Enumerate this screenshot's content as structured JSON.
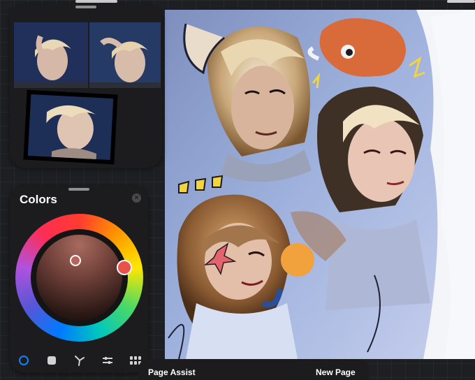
{
  "colors_panel": {
    "title": "Colors",
    "close_icon": "close-icon",
    "current_color": "#b7645c",
    "tabs": [
      {
        "name": "disc",
        "icon": "color-disc-icon",
        "active": true
      },
      {
        "name": "classic",
        "icon": "classic-square-icon",
        "active": false
      },
      {
        "name": "harmony",
        "icon": "harmony-icon",
        "active": false
      },
      {
        "name": "value",
        "icon": "sliders-icon",
        "active": false
      },
      {
        "name": "palettes",
        "icon": "palette-grid-icon",
        "active": false
      }
    ]
  },
  "bottom_bar": {
    "left_label": "Page Assist",
    "right_label": "New Page"
  },
  "colors": {
    "panel_bg": "#1c1c1e",
    "accent_blue": "#0a84ff",
    "canvas_bg": "#f4f5f8"
  }
}
